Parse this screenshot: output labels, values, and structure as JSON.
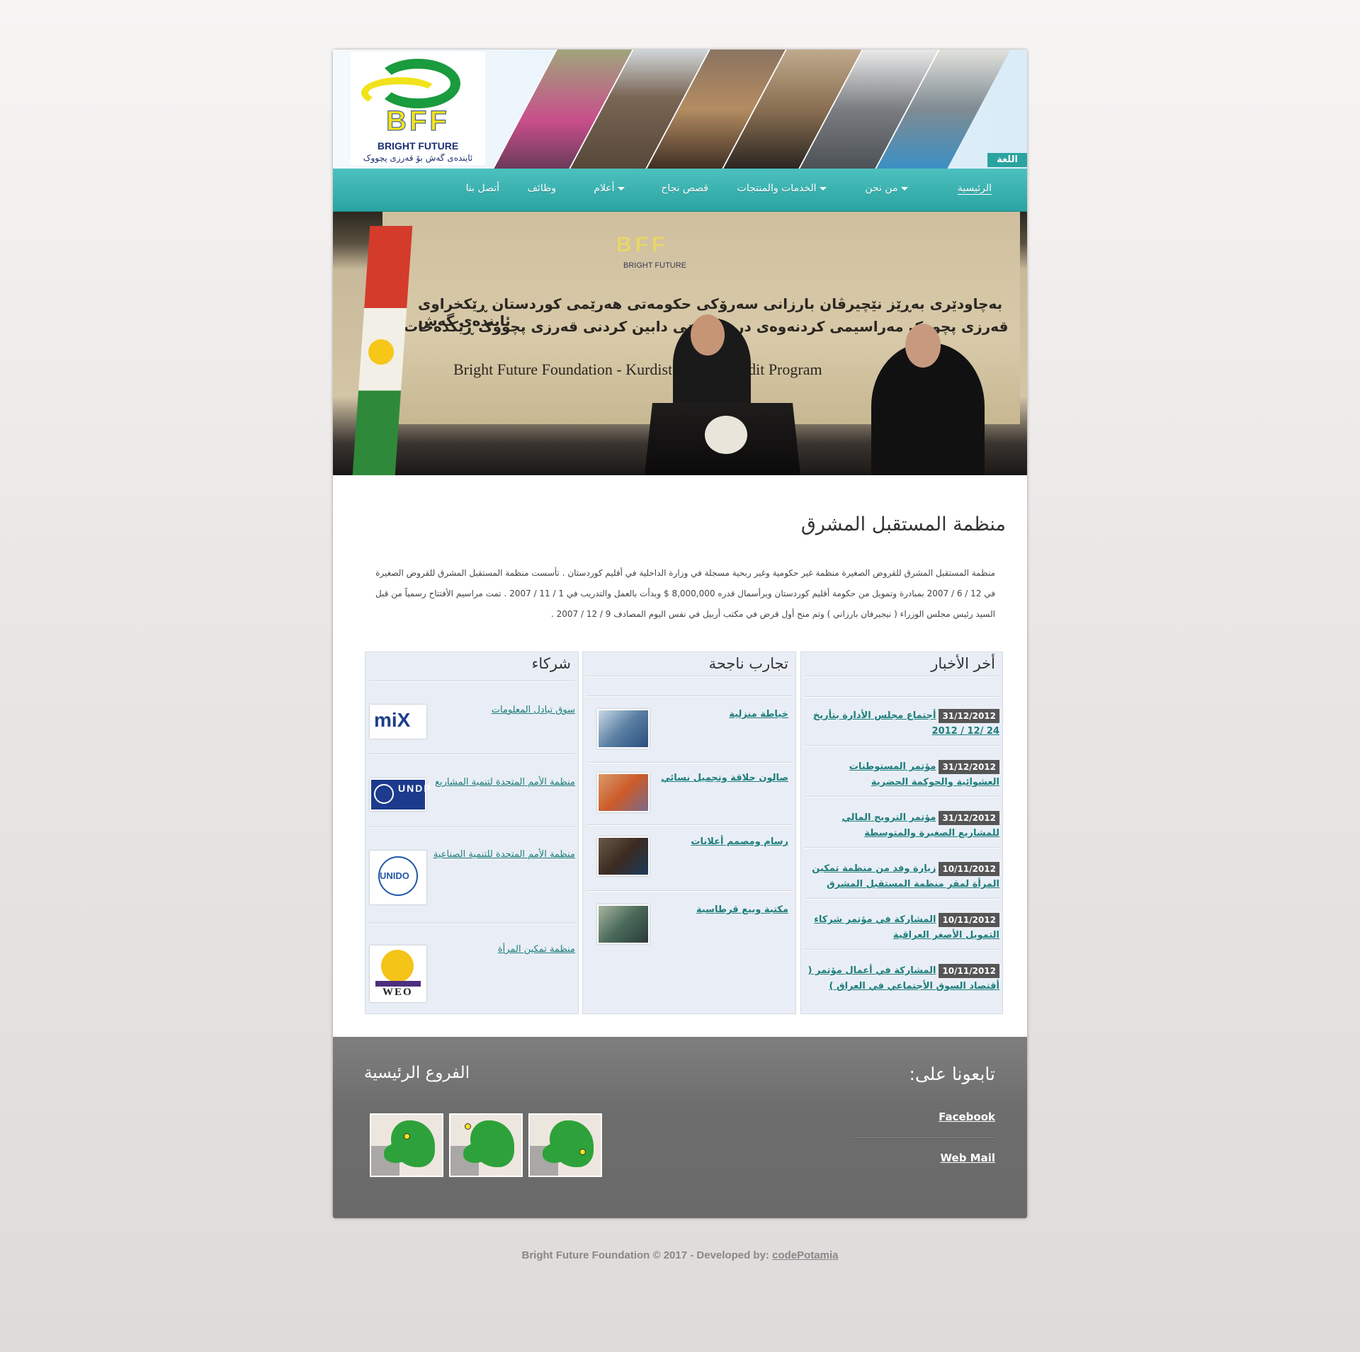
{
  "header": {
    "logo_text": "BFF",
    "logo_name_en": "BRIGHT FUTURE",
    "logo_name_ku": "ئاینده‌ی گه‌ش بۆ قه‌رزی پچووک",
    "language_button": "اللغة"
  },
  "nav": {
    "items": [
      {
        "label": "الرئيسية",
        "dropdown": false
      },
      {
        "label": "من نحن",
        "dropdown": true
      },
      {
        "label": "الخدمات والمنتجات",
        "dropdown": true
      },
      {
        "label": "قصص نجاح",
        "dropdown": false
      },
      {
        "label": "أعلام",
        "dropdown": true
      },
      {
        "label": "وظائف",
        "dropdown": false
      },
      {
        "label": "أتصل بنا",
        "dropdown": false
      }
    ]
  },
  "banner": {
    "logo": "BFF",
    "logo_sub": "BRIGHT FUTURE",
    "line1": "بەچاودێری بەڕێز نێچیرڤان بارزانی سەرۆکی حکومەتی هەرێمی کوردستان ڕێکخراوی ئایندەی گەش",
    "line2": "قەرزی پچووک مەراسیمی کردنەوەی دریژخایەنی دابین کردنی قەرزی پچووک ڕێکدەخات",
    "line3": "Bright Future Foundation - Kurdistan Microcredit Program"
  },
  "main": {
    "title": "منظمة المستقبل المشرق",
    "intro": "منظمة المستقبل المشرق للقروض الصغيرة منظمة غير حكومية وغير ربحية مسجلة في وزارة الداخلية في أقليم كوردستان . تأسست منظمة المستقبل المشرق للقروض الصغيرة في 12 / 6 / 2007 بمبادرة وتمويل من حكومة أقليم كوردستان وبرأسمال قدره 8,000,000 $ وبدأت بالعمل والتدريب في 1 / 11 / 2007 . تمت مراسيم الأفتتاح رسمياً من قبل السيد رئيس مجلس الوزراء ( نيجيرفان بارزاني ) وتم منح أول قرض في مكتب أربيل في نفس اليوم المصادف 9 / 12 / 2007 ."
  },
  "news": {
    "title": "أخر الأخبار",
    "items": [
      {
        "date": "31/12/2012",
        "text": "أجتماع مجلس الأدارة بتأريخ 24 /12 / 2012"
      },
      {
        "date": "31/12/2012",
        "text": "مؤتمر المستوطنات العشوائية والحوكمة الحضرية"
      },
      {
        "date": "31/12/2012",
        "text": "مؤتمر الترويج المالي للمشاريع الصغيرة والمتوسطة"
      },
      {
        "date": "10/11/2012",
        "text": "زيارة وفد من منظمة تمكين المرأة لمقر منظمة المستقبل المشرق"
      },
      {
        "date": "10/11/2012",
        "text": "المشاركة في مؤتمر شركاء التمويل الأصغر العراقية"
      },
      {
        "date": "10/11/2012",
        "text": "المشاركة في أعمال مؤتمر ( أقتصاد السوق الأجتماعي في العراق )"
      }
    ]
  },
  "stories": {
    "title": "تجارب ناجحة",
    "items": [
      {
        "text": "خياطة منزلية"
      },
      {
        "text": "صالون حلاقة وتجميل نسائي"
      },
      {
        "text": "رسام ومصمم أعلانات"
      },
      {
        "text": "مكتبة وبيع قرطاسية"
      }
    ]
  },
  "partners": {
    "title": "شركاء",
    "items": [
      {
        "text": "سوق تبادل المعلومات",
        "logo": "miX"
      },
      {
        "text": "منظمة الأمم المتحدة لتنمية المشاريع",
        "logo": "UNDP"
      },
      {
        "text": "منظمة الأمم المتحدة للتنمية الصناعية",
        "logo": "UNIDO"
      },
      {
        "text": "منظمة تمكين المرأة",
        "logo": "WEO"
      }
    ]
  },
  "footer": {
    "follow_title": "تابعونا على:",
    "facebook": "Facebook",
    "webmail": "Web Mail",
    "branches_title": "الفروع الرئيسية",
    "copyright": "Bright Future Foundation © 2017 - Developed by:",
    "developer": "codePotamia"
  },
  "colors": {
    "nav": "#2aa4a2",
    "link": "#1d7d7b",
    "logo_green": "#1a9b3e",
    "logo_yellow": "#f2e21a",
    "logo_blue": "#2c4da0"
  }
}
